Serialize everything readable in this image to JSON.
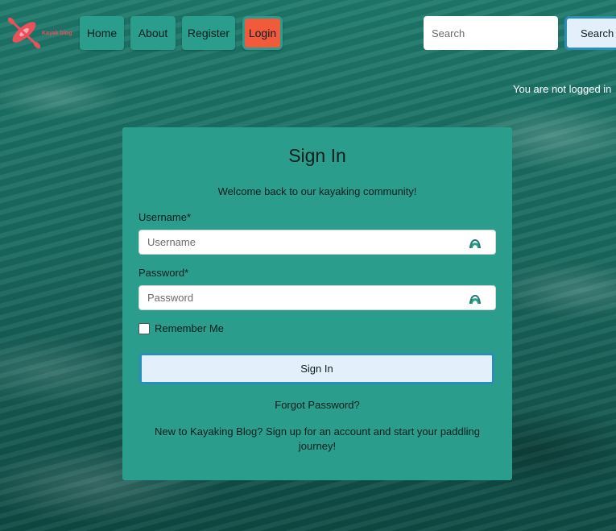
{
  "brand": {
    "logo_text": "Kayak blog",
    "logo_color": "#e8505b"
  },
  "nav": {
    "items": [
      {
        "label": "Home"
      },
      {
        "label": "About"
      },
      {
        "label": "Register"
      },
      {
        "label": "Login"
      }
    ]
  },
  "search": {
    "placeholder": "Search",
    "button_label": "Search"
  },
  "status": {
    "login_text": "You are not logged in"
  },
  "signin": {
    "title": "Sign In",
    "subtitle": "Welcome back to our kayaking community!",
    "username_label": "Username*",
    "username_placeholder": "Username",
    "password_label": "Password*",
    "password_placeholder": "Password",
    "remember_label": "Remember Me",
    "submit_label": "Sign In",
    "forgot_label": "Forgot Password?",
    "signup_note": "New to Kayaking Blog? Sign up for an account and start your paddling journey!"
  },
  "colors": {
    "card": "#2b9d8c",
    "nav_button": "#2b9d8c",
    "login_button": "#f25a3c",
    "primary_button": "#e3f0fb",
    "primary_button_border": "#2a8fb8",
    "field_icon": "#2b9d8c"
  }
}
